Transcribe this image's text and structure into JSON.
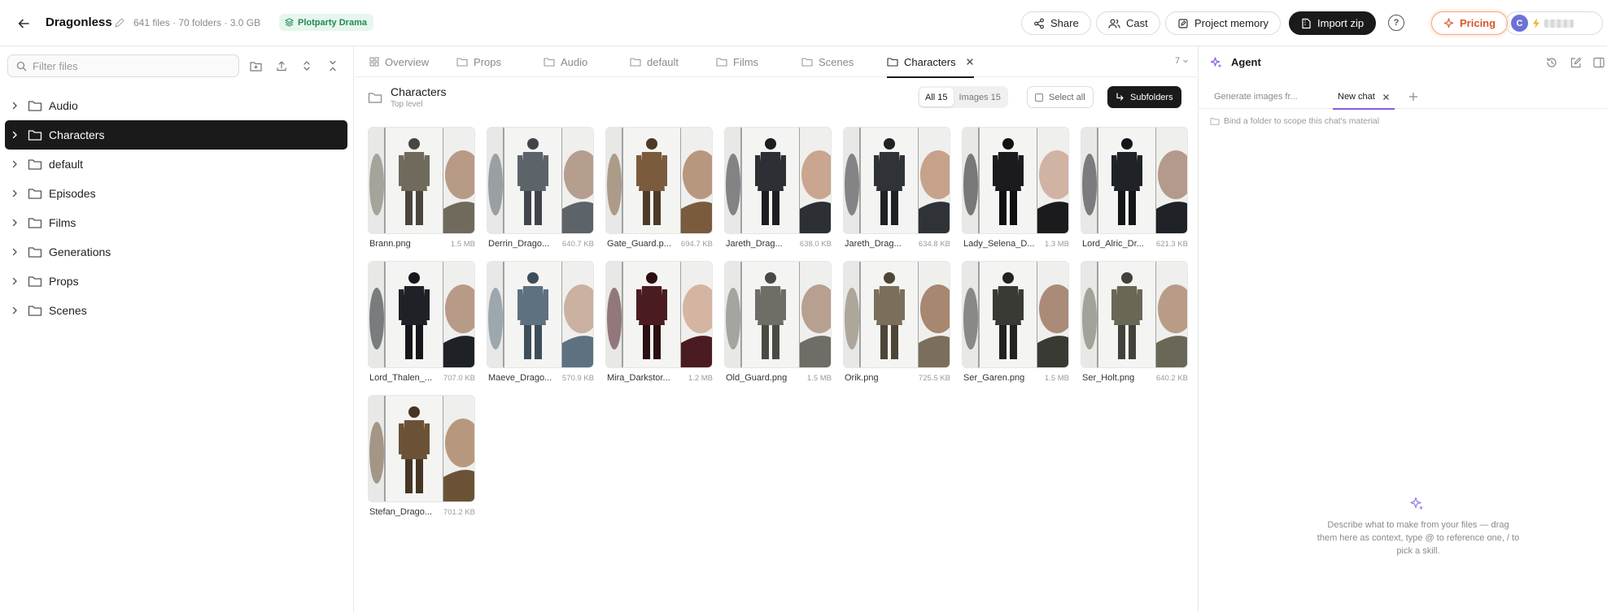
{
  "header": {
    "project_title": "Dragonless",
    "project_meta": "641 files · 70 folders · 3.0 GB",
    "badge": "Plotparty Drama",
    "share": "Share",
    "cast": "Cast",
    "project_memory": "Project memory",
    "import_zip": "Import zip",
    "pricing": "Pricing",
    "avatar_letter": "C"
  },
  "sidebar": {
    "filter_placeholder": "Filter files",
    "items": [
      {
        "label": "Audio",
        "active": false
      },
      {
        "label": "Characters",
        "active": true
      },
      {
        "label": "default",
        "active": false
      },
      {
        "label": "Episodes",
        "active": false
      },
      {
        "label": "Films",
        "active": false
      },
      {
        "label": "Generations",
        "active": false
      },
      {
        "label": "Props",
        "active": false
      },
      {
        "label": "Scenes",
        "active": false
      }
    ]
  },
  "tabs": {
    "overview": "Overview",
    "props": "Props",
    "audio": "Audio",
    "default": "default",
    "films": "Films",
    "scenes": "Scenes",
    "characters": "Characters",
    "count": "7"
  },
  "folder": {
    "title": "Characters",
    "subtitle": "Top level",
    "all": "All 15",
    "images": "Images 15",
    "select_all": "Select all",
    "subfolders": "Subfolders"
  },
  "files": [
    {
      "name": "Brann.png",
      "size": "1.5 MB"
    },
    {
      "name": "Derrin_Drago...",
      "size": "640.7 KB"
    },
    {
      "name": "Gate_Guard.p...",
      "size": "694.7 KB"
    },
    {
      "name": "Jareth_Drag...",
      "size": "638.0 KB"
    },
    {
      "name": "Jareth_Drag...",
      "size": "634.8 KB"
    },
    {
      "name": "Lady_Selena_D...",
      "size": "1.3 MB"
    },
    {
      "name": "Lord_Alric_Dr...",
      "size": "621.3 KB"
    },
    {
      "name": "Lord_Thalen_...",
      "size": "707.0 KB"
    },
    {
      "name": "Maeve_Drago...",
      "size": "570.9 KB"
    },
    {
      "name": "Mira_Darkstor...",
      "size": "1.2 MB"
    },
    {
      "name": "Old_Guard.png",
      "size": "1.5 MB"
    },
    {
      "name": "Orik.png",
      "size": "725.5 KB"
    },
    {
      "name": "Ser_Garen.png",
      "size": "1.5 MB"
    },
    {
      "name": "Ser_Holt.png",
      "size": "640.2 KB"
    },
    {
      "name": "Stefan_Drago...",
      "size": "701.2 KB"
    }
  ],
  "agent": {
    "title": "Agent",
    "chat_tab_1": "Generate images fr...",
    "chat_tab_2": "New chat",
    "bind_folder": "Bind a folder to scope this chat's material",
    "hint": "Describe what to make from your files — drag them here as context, type @ to reference one, / to pick a skill."
  },
  "colors": {
    "accent_dark": "#1a1a1a",
    "badge_green": "#1f8a55",
    "pricing_orange": "#d9552a",
    "agent_purple": "#8c5ce0"
  }
}
